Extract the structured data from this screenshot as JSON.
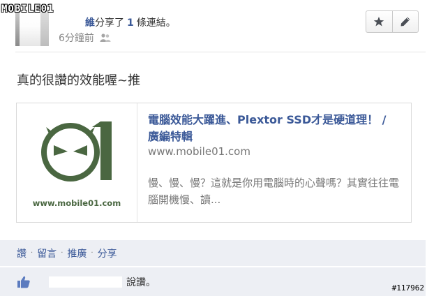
{
  "watermark": {
    "text": "MOBILE01"
  },
  "post": {
    "share_text_before": "",
    "author_suffix": "維",
    "share_text": "分享了",
    "link_count": "1",
    "share_text_after": "條連結。",
    "time_ago": "6分鐘前",
    "body": "真的很讚的效能喔~推"
  },
  "actions": {
    "star_icon": "star-icon",
    "edit_icon": "pencil-icon"
  },
  "link": {
    "title": "電腦效能大躍進、Plextor SSD才是硬道理！ / 廣編特輯",
    "domain": "www.mobile01.com",
    "description": "慢、慢、慢？這就是你用電腦時的心聲嗎？其實往往電腦開機慢、讀...",
    "thumb_caption": "www.mobile01.com"
  },
  "action_bar": {
    "like": "讚",
    "comment": "留言",
    "promote": "推廣",
    "share": "分享"
  },
  "likes": {
    "suffix": "說讚。"
  },
  "image_id": "#117962",
  "colors": {
    "brand": "#3b5998",
    "logo_green": "#4a6741",
    "bar_bg": "#edeff4"
  }
}
